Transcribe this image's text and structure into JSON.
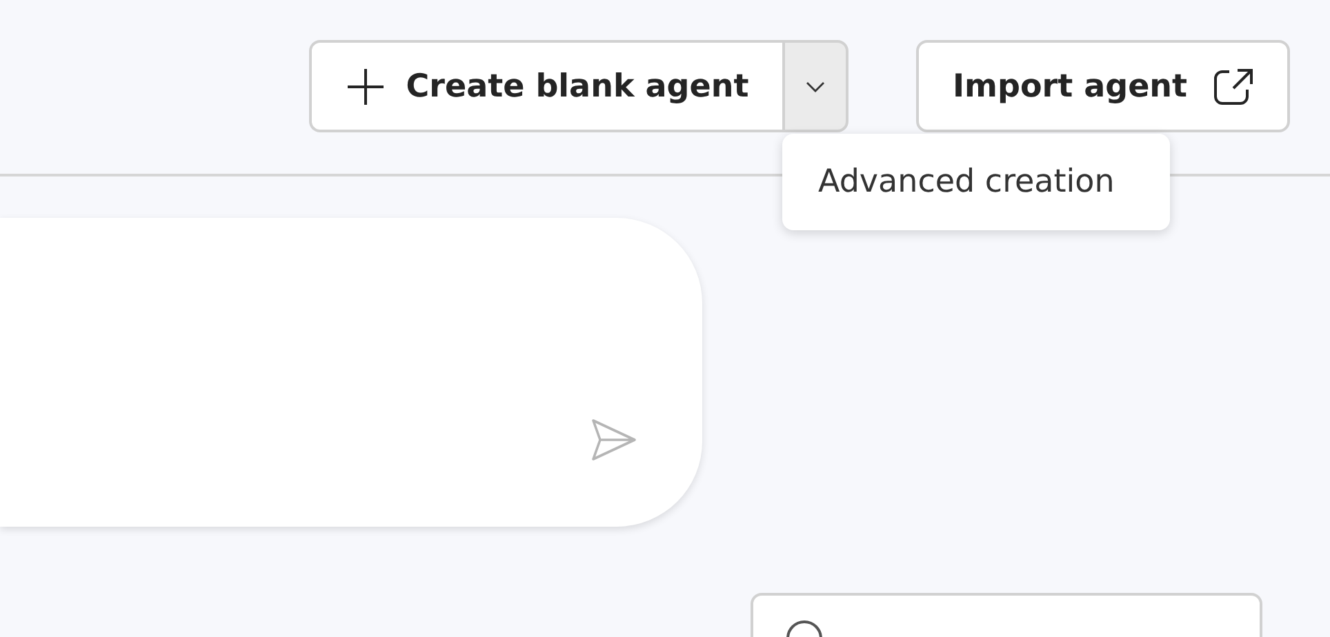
{
  "toolbar": {
    "create_button": {
      "label": "Create blank agent"
    },
    "create_dropdown": {
      "expanded": true
    },
    "import_button": {
      "label": "Import agent"
    }
  },
  "dropdown_menu": {
    "items": [
      {
        "label": "Advanced creation"
      }
    ]
  }
}
